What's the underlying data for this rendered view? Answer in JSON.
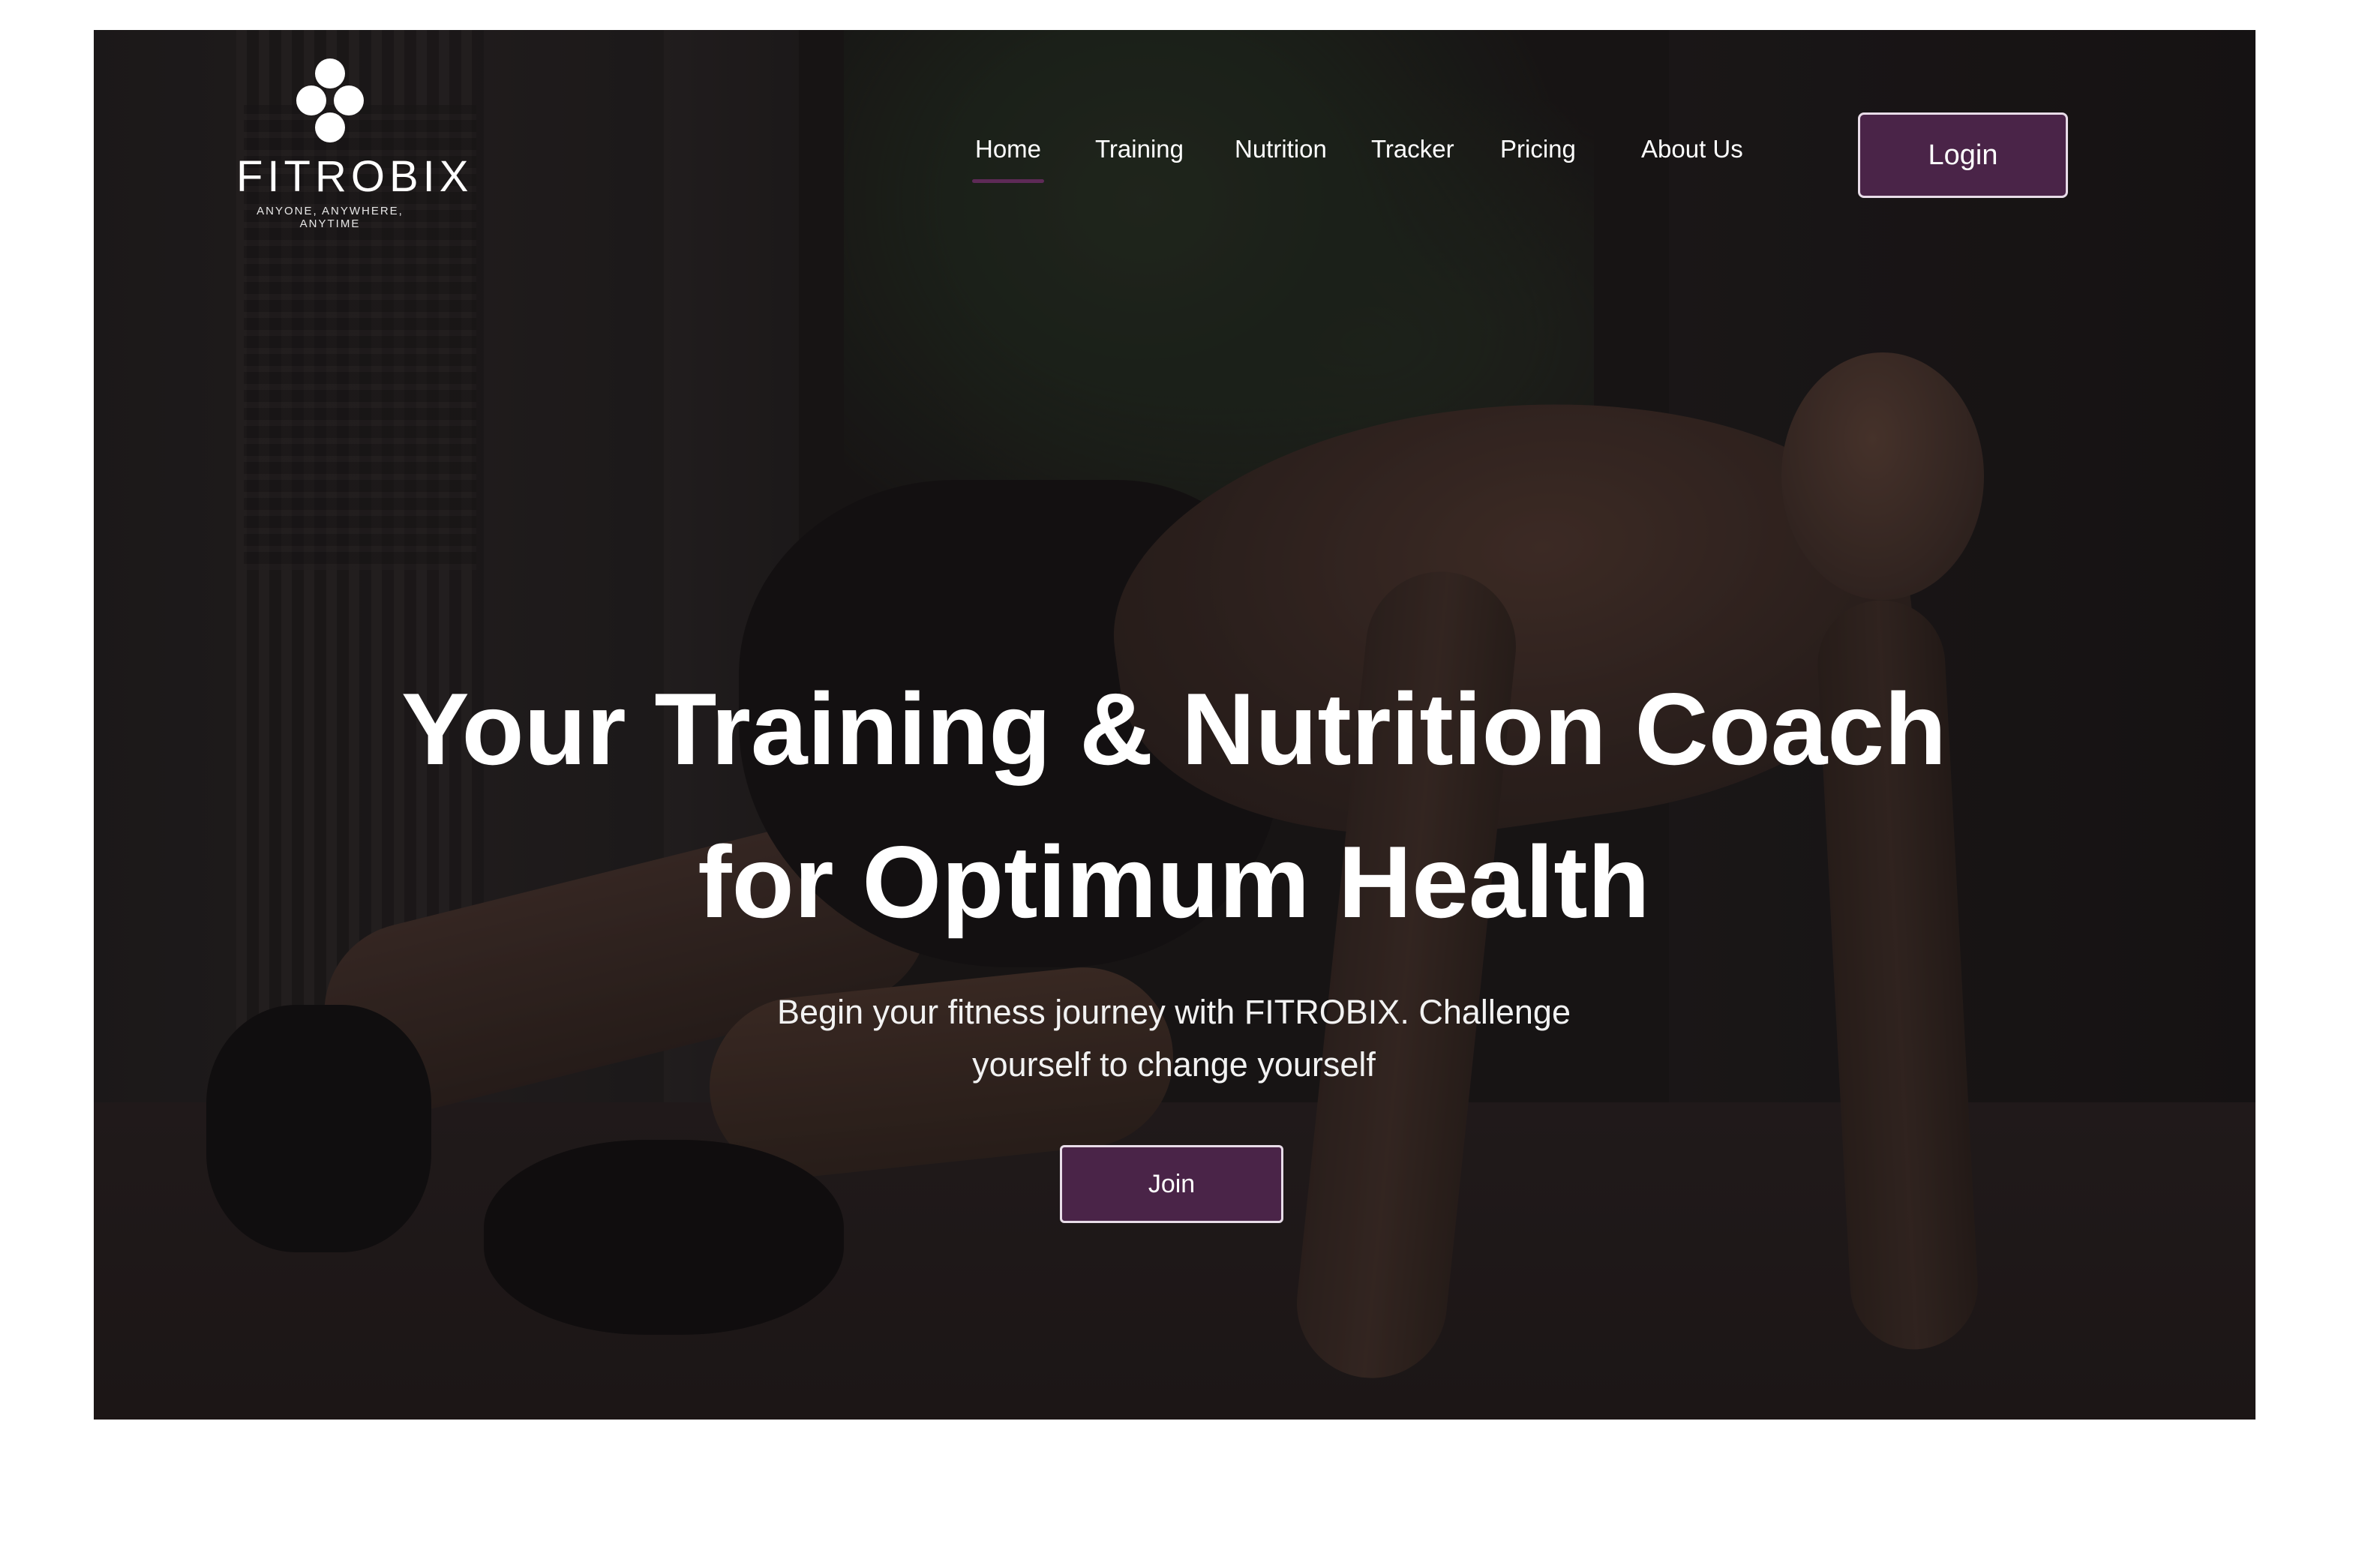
{
  "brand": {
    "name": "FITROBIX",
    "tagline": "ANYONE, ANYWHERE, ANYTIME",
    "logo_icon": "four-dots-logo-icon"
  },
  "nav": {
    "items": [
      {
        "label": "Home",
        "active": true
      },
      {
        "label": "Training",
        "active": false
      },
      {
        "label": "Nutrition",
        "active": false
      },
      {
        "label": "Tracker",
        "active": false
      },
      {
        "label": "Pricing",
        "active": false
      },
      {
        "label": "About Us",
        "active": false
      }
    ],
    "login_label": "Login"
  },
  "hero": {
    "title": "Your Training & Nutrition Coach for Optimum Health",
    "subtitle": "Begin your fitness journey with FITROBIX. Challenge yourself to change yourself",
    "join_label": "Join"
  },
  "colors": {
    "accent": "#4a2448",
    "active_underline": "#5e2a57",
    "text": "#ffffff",
    "button_border": "#e8dce8"
  }
}
